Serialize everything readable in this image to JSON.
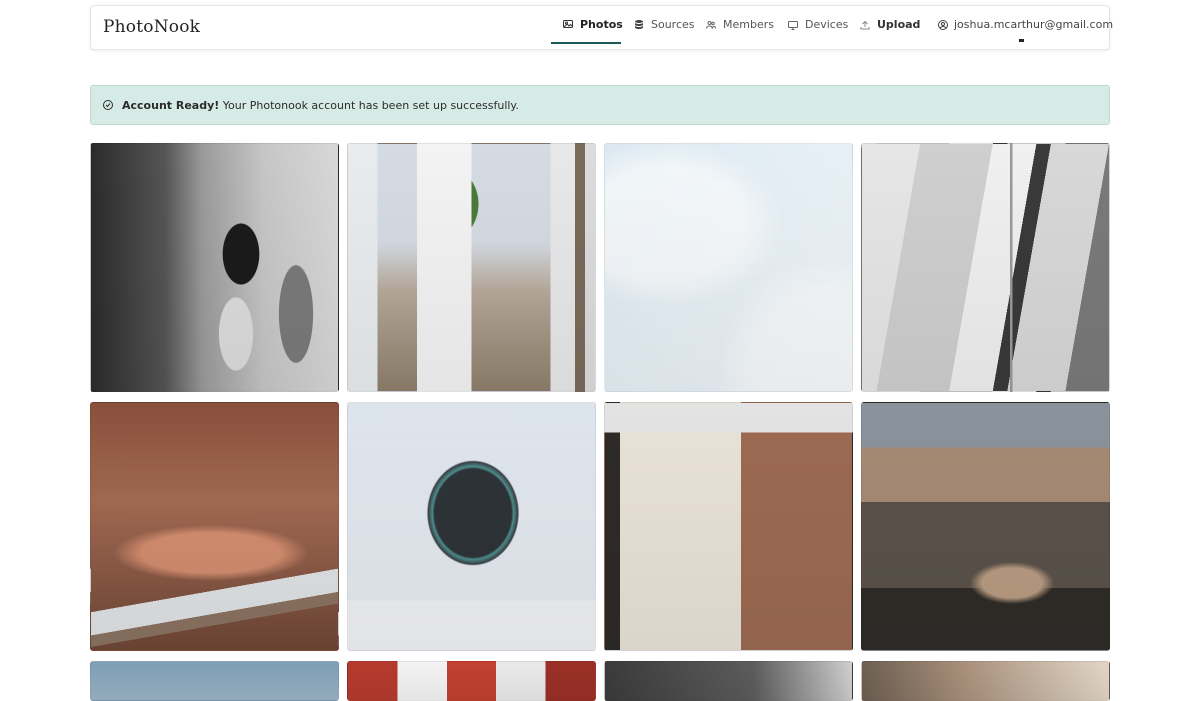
{
  "app": {
    "brand": "PhotoNook"
  },
  "nav": {
    "items": [
      {
        "label": "Photos",
        "icon": "image-icon",
        "active": true
      },
      {
        "label": "Sources",
        "icon": "database-icon",
        "active": false
      },
      {
        "label": "Members",
        "icon": "users-icon",
        "active": false
      },
      {
        "label": "Devices",
        "icon": "monitor-icon",
        "active": false
      },
      {
        "label": "Upload",
        "icon": "upload-icon",
        "active": false
      }
    ],
    "user_email": "joshua.mcarthur@gmail.com"
  },
  "alert": {
    "title": "Account Ready!",
    "message": "Your Photonook account has been set up successfully."
  },
  "colors": {
    "accent": "#1d5a57",
    "alert_bg": "#d6ebe5"
  }
}
